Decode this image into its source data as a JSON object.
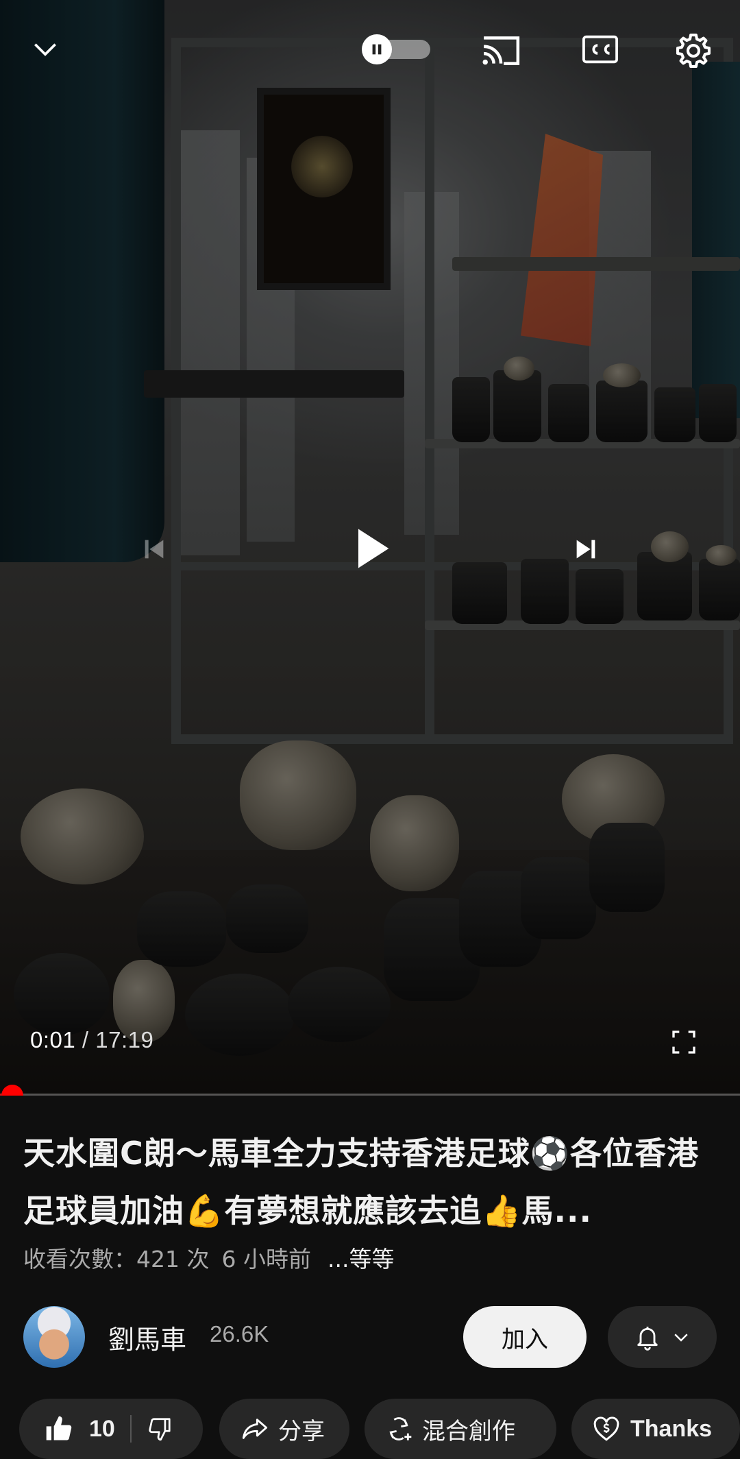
{
  "player": {
    "current_time": "0:01",
    "separator": " / ",
    "duration": "17:19",
    "progress_fraction": 0.001,
    "autoplay_on": false
  },
  "video": {
    "title": "天水圍C朗～馬車全力支持香港足球⚽各位香港足球員加油💪有夢想就應該去追👍馬...",
    "views": "收看次數：421 次",
    "time_ago": "6 小時前",
    "more_label": "...等等"
  },
  "channel": {
    "name": "劉馬車",
    "subscribers": "26.6K",
    "join_label": "加入"
  },
  "actions": {
    "like_count": "10",
    "share_label": "分享",
    "remix_label": "混合創作",
    "thanks_label": "Thanks"
  },
  "colors": {
    "background": "#0f0f0f",
    "chip": "#272727",
    "accent_red": "#ff0000",
    "text_primary": "#f1f1f1",
    "text_secondary": "#aaaaaa"
  },
  "icons": [
    "chevron-down-icon",
    "pause-icon",
    "cast-icon",
    "cc-icon",
    "gear-icon",
    "previous-icon",
    "play-icon",
    "next-icon",
    "fullscreen-icon",
    "bell-icon",
    "like-icon",
    "dislike-icon",
    "share-icon",
    "remix-icon",
    "thanks-icon"
  ]
}
